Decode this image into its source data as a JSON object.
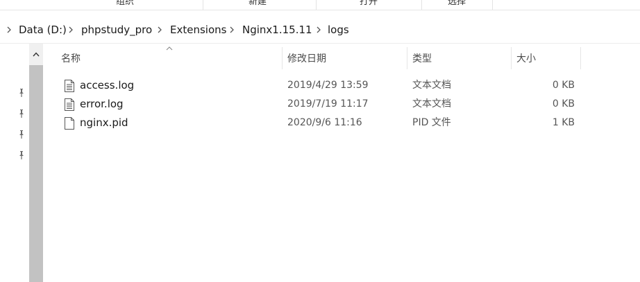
{
  "ribbon": {
    "groups": [
      {
        "label": "组织"
      },
      {
        "label": "新建"
      },
      {
        "label": "打开"
      },
      {
        "label": "选择"
      }
    ]
  },
  "address": {
    "crumbs": [
      "Data (D:)",
      "phpstudy_pro",
      "Extensions",
      "Nginx1.15.11",
      "logs"
    ]
  },
  "columns": {
    "name": "名称",
    "date": "修改日期",
    "type": "类型",
    "size": "大小"
  },
  "files": [
    {
      "name": "access.log",
      "date": "2019/4/29 13:59",
      "type": "文本文档",
      "size": "0 KB",
      "icon": "text-document-icon"
    },
    {
      "name": "error.log",
      "date": "2019/7/19 11:17",
      "type": "文本文档",
      "size": "0 KB",
      "icon": "text-document-icon"
    },
    {
      "name": "nginx.pid",
      "date": "2020/9/6 11:16",
      "type": "PID 文件",
      "size": "1 KB",
      "icon": "blank-file-icon"
    }
  ],
  "navpane": {
    "pins": [
      "pin-icon",
      "pin-icon",
      "pin-icon",
      "pin-icon"
    ]
  }
}
